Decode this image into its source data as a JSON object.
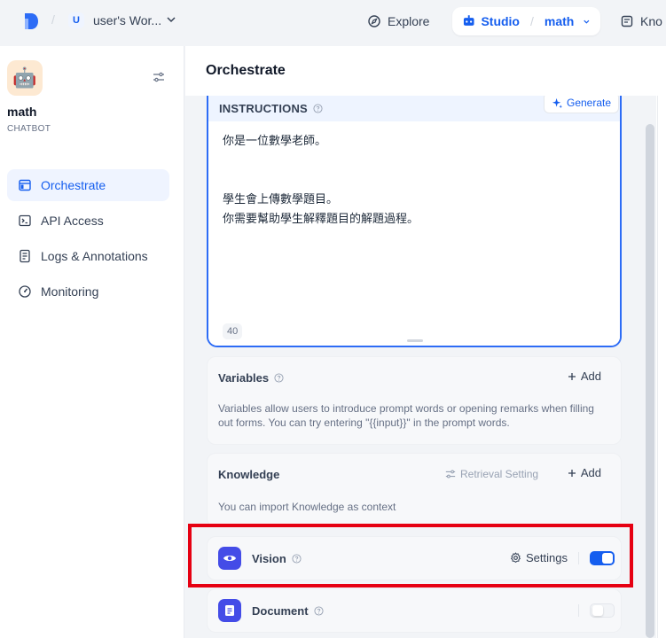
{
  "topbar": {
    "workspace_initial": "U",
    "workspace_name": "user's Wor...",
    "explore_label": "Explore",
    "studio_label": "Studio",
    "current_app": "math",
    "knowledge_label": "Kno"
  },
  "sidebar": {
    "app_name": "math",
    "app_type": "CHATBOT",
    "app_icon": "🤖",
    "items": [
      {
        "label": "Orchestrate",
        "icon": "window-icon",
        "active": true
      },
      {
        "label": "API Access",
        "icon": "terminal-icon",
        "active": false
      },
      {
        "label": "Logs & Annotations",
        "icon": "document-list-icon",
        "active": false
      },
      {
        "label": "Monitoring",
        "icon": "gauge-icon",
        "active": false
      }
    ]
  },
  "main": {
    "title": "Orchestrate",
    "instructions": {
      "label": "INSTRUCTIONS",
      "generate_label": "Generate",
      "text": "你是一位數學老師。\n\n\n學生會上傳數學題目。\n你需要幫助學生解釋題目的解題過程。",
      "char_count": "40"
    },
    "variables": {
      "title": "Variables",
      "add_label": "Add",
      "description": "Variables allow users to introduce prompt words or opening remarks when filling out forms. You can try entering \"{{input}}\" in the prompt words."
    },
    "knowledge": {
      "title": "Knowledge",
      "retrieval_label": "Retrieval Setting",
      "add_label": "Add",
      "description": "You can import Knowledge as context"
    },
    "vision": {
      "title": "Vision",
      "settings_label": "Settings",
      "enabled": true
    },
    "document": {
      "title": "Document",
      "enabled": false
    }
  },
  "colors": {
    "accent": "#155eef",
    "highlight": "#e60012",
    "feature_icon_bg": "#444ce7"
  }
}
